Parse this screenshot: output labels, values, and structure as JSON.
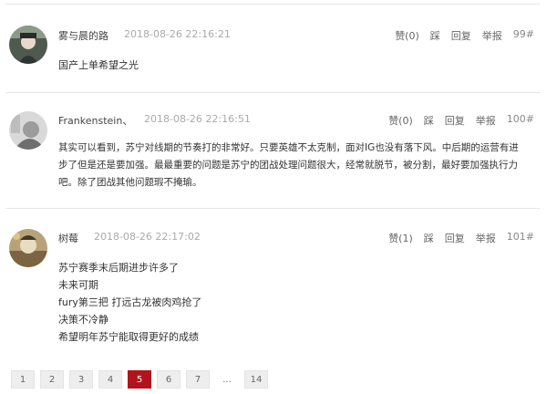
{
  "comments": [
    {
      "username": "雾与晨的路",
      "time": "2018-08-26 22:16:21",
      "like": "赞(0)",
      "dislike": "踩",
      "reply": "回复",
      "report": "举报",
      "floor": "99#",
      "lines": [
        "国产上单希望之光"
      ]
    },
    {
      "username": "Frankenstein、",
      "time": "2018-08-26 22:16:51",
      "like": "赞(0)",
      "dislike": "踩",
      "reply": "回复",
      "report": "举报",
      "floor": "100#",
      "lines": [
        "其实可以看到，苏宁对线期的节奏打的非常好。只要英雄不太克制，面对IG也没有落下风。中后期的运营有进",
        "步了但是还是要加强。最最重要的问题是苏宁的团战处理问题很大，经常就脱节，被分割，最好要加强执行力",
        "吧。除了团战其他问题瑕不掩瑜。"
      ]
    },
    {
      "username": "树莓",
      "time": "2018-08-26 22:17:02",
      "like": "赞(1)",
      "dislike": "踩",
      "reply": "回复",
      "report": "举报",
      "floor": "101#",
      "lines": [
        "苏宁赛季末后期进步许多了",
        "未来可期",
        "fury第三把 打远古龙被肉鸡抢了",
        "决策不冷静",
        "希望明年苏宁能取得更好的成绩"
      ]
    }
  ],
  "pagination": {
    "pages": [
      "1",
      "2",
      "3",
      "4",
      "5",
      "6",
      "7",
      "...",
      "14"
    ],
    "active": "5"
  },
  "colors": {
    "accent": "#b1151c"
  }
}
